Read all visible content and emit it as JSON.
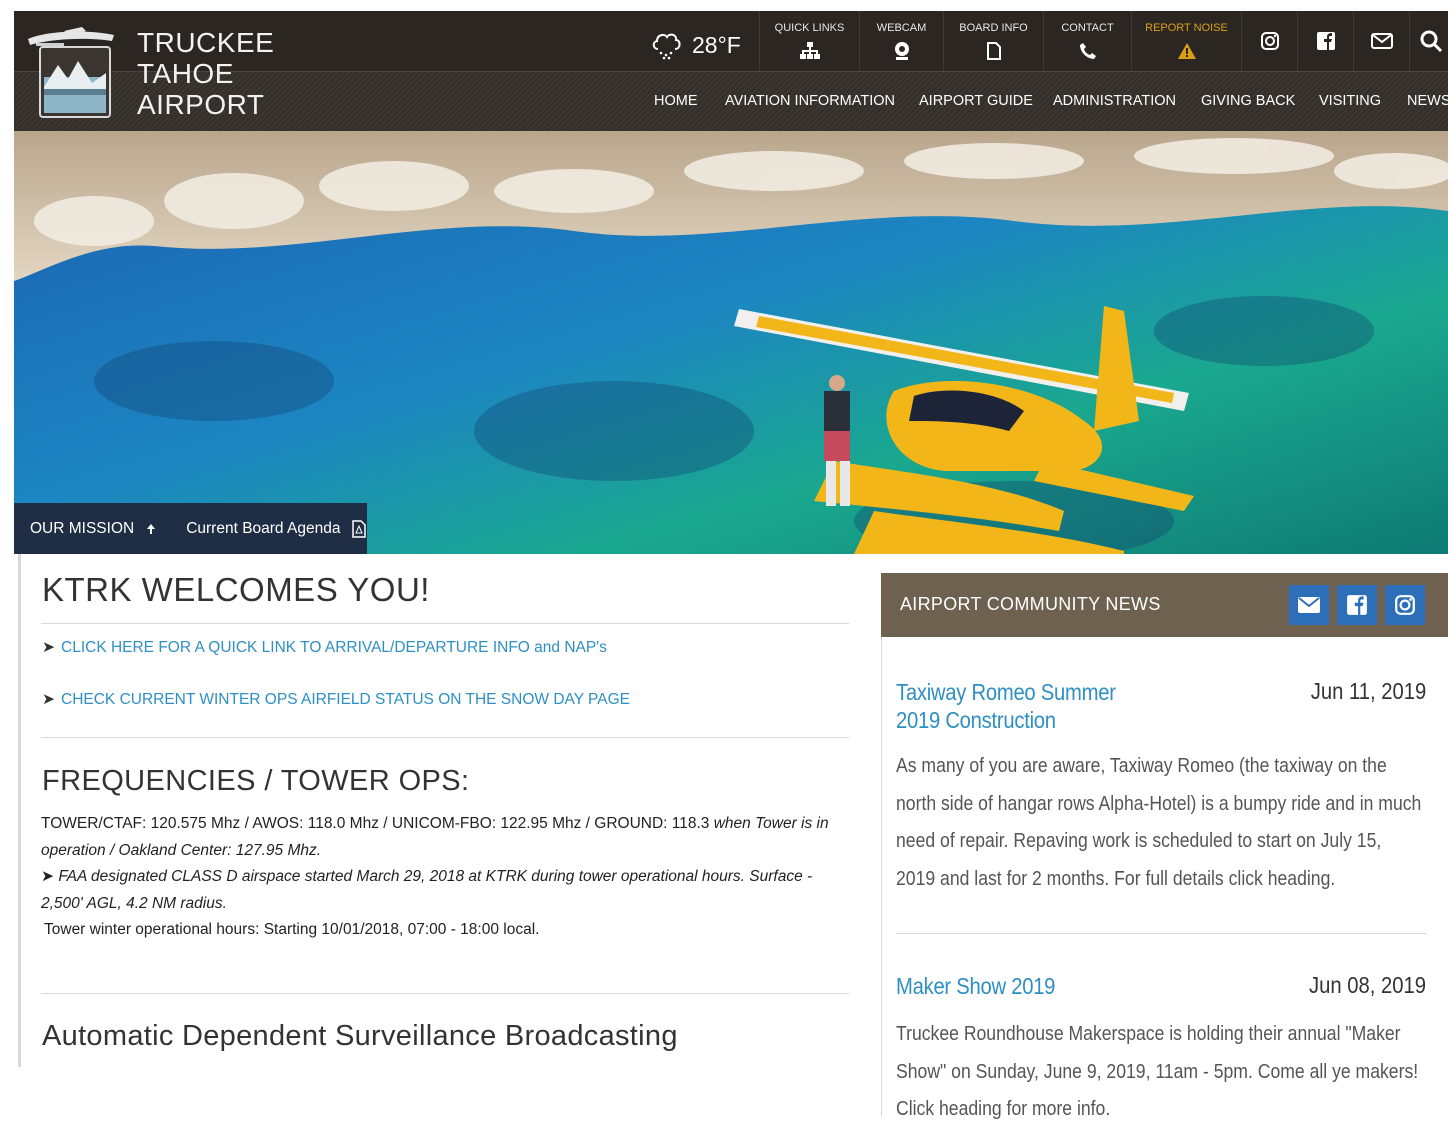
{
  "logo": {
    "line1": "TRUCKEE",
    "line2": "TAHOE",
    "line3": "AIRPORT"
  },
  "weather": {
    "temp": "28°F",
    "icon": "cloud-snow-icon"
  },
  "quicklinks": [
    {
      "label": "QUICK LINKS",
      "icon": "sitemap-icon"
    },
    {
      "label": "WEBCAM",
      "icon": "webcam-icon"
    },
    {
      "label": "BOARD INFO",
      "icon": "document-icon"
    },
    {
      "label": "CONTACT",
      "icon": "phone-icon"
    },
    {
      "label": "REPORT NOISE",
      "icon": "warning-icon"
    }
  ],
  "social": [
    "instagram-icon",
    "facebook-icon",
    "mail-icon",
    "search-icon"
  ],
  "nav": [
    "HOME",
    "AVIATION INFORMATION",
    "AIRPORT GUIDE",
    "ADMINISTRATION",
    "GIVING BACK",
    "VISITING",
    "NEWS"
  ],
  "hero": {
    "mission": "OUR MISSION",
    "agenda": "Current Board Agenda"
  },
  "welcome": {
    "title": "KTRK WELCOMES YOU!",
    "link1": "CLICK HERE FOR A QUICK LINK TO ARRIVAL/DEPARTURE INFO and NAP's",
    "link2": "CHECK CURRENT WINTER OPS AIRFIELD STATUS ON THE SNOW DAY PAGE"
  },
  "frequencies": {
    "title": "FREQUENCIES / TOWER OPS:",
    "line1": "TOWER/CTAF: 120.575 Mhz / AWOS: 118.0 Mhz / UNICOM-FBO: 122.95 Mhz / GROUND: 118.3 ",
    "line1_italic": "when Tower is in operation / Oakland Center: 127.95 Mhz.",
    "line2": "FAA designated CLASS D airspace started March 29, 2018 at KTRK during tower operational hours.  Surface - 2,500' AGL, 4.2 NM radius.",
    "line3": "Tower winter operational hours:  Starting 10/01/2018,  07:00 - 18:00 local."
  },
  "adsb_title": "Automatic Dependent Surveillance Broadcasting",
  "news": {
    "title": "AIRPORT COMMUNITY NEWS",
    "items": [
      {
        "title": "Taxiway Romeo Summer 2019 Construction",
        "date": "Jun 11, 2019",
        "text": "As many of you are aware, Taxiway Romeo (the taxiway on the north side of hangar rows Alpha-Hotel) is a bumpy ride and in much need of repair. Repaving work is scheduled to start on July 15, 2019 and last for 2 months. For full details click heading."
      },
      {
        "title": "Maker Show 2019",
        "date": "Jun 08, 2019",
        "text": "Truckee Roundhouse Makerspace is holding their annual \"Maker Show\" on Sunday, June 9, 2019, 11am - 5pm.  Come all ye makers!  Click heading for more info."
      }
    ]
  },
  "colors": {
    "header": "#2b2622",
    "accent_link": "#2e8fc4",
    "news_head": "#6e6150",
    "social_btn": "#2c6eb8",
    "noise": "#d9a01a",
    "hero_bar": "#1f2e44"
  }
}
